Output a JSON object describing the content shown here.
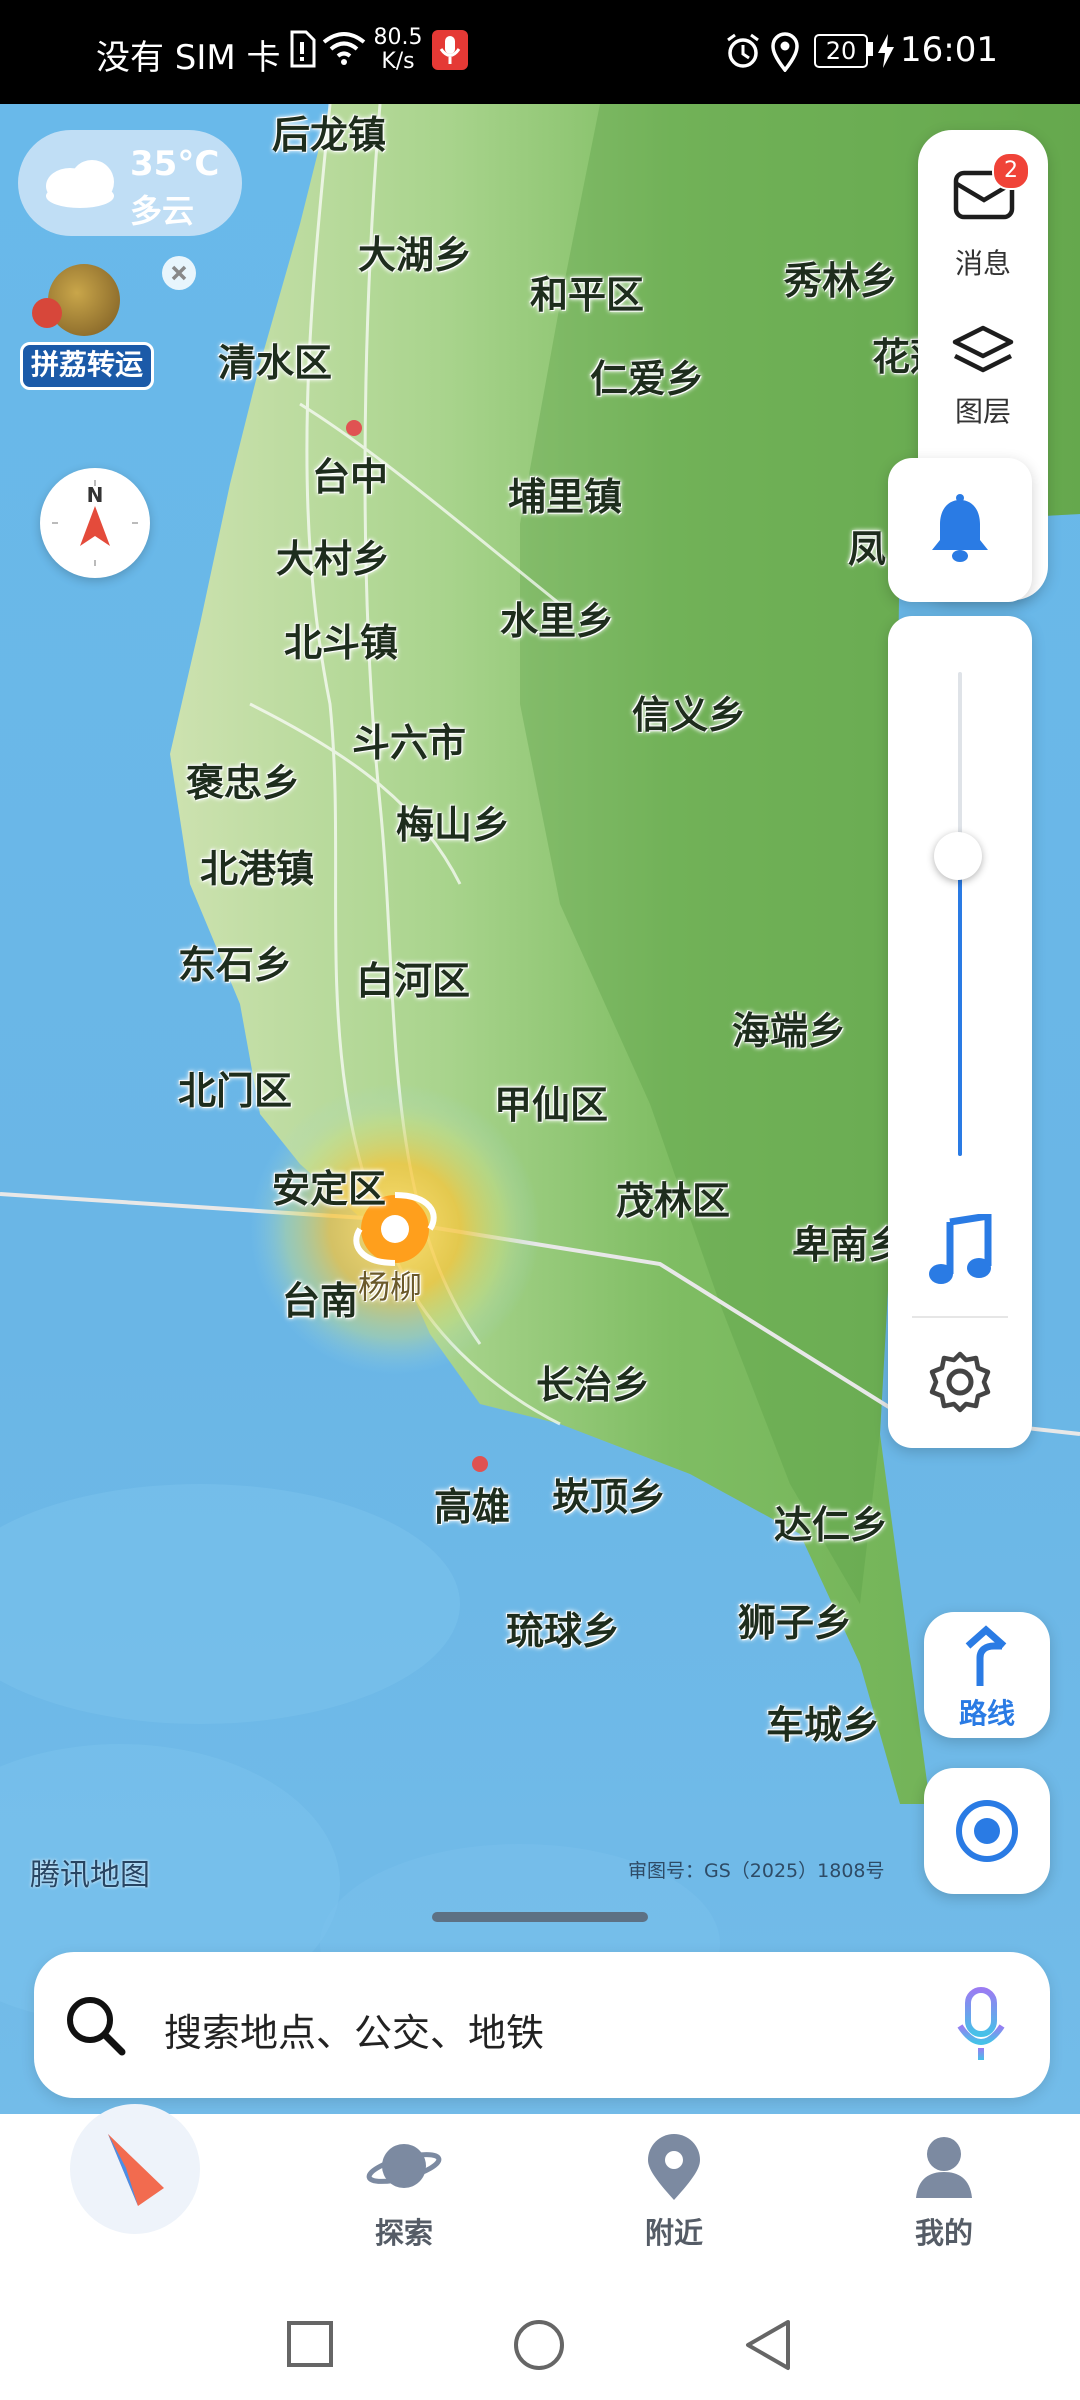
{
  "status_bar": {
    "sim": "没有 SIM 卡",
    "speed_value": "80.5",
    "speed_unit": "K/s",
    "battery": "20",
    "time": "16:01"
  },
  "weather": {
    "temperature": "35°C",
    "condition": "多云"
  },
  "promo": {
    "label": "拼荔转运"
  },
  "right_panel": {
    "messages_label": "消息",
    "messages_badge": "2",
    "layers_label": "图层"
  },
  "volume_level_percent": 62,
  "route_button": {
    "label": "路线"
  },
  "typhoon": {
    "name": "杨柳"
  },
  "map": {
    "watermark": "腾讯地图",
    "approval": "审图号：GS（2025）1808号",
    "places": [
      "后龙镇",
      "大湖乡",
      "和平区",
      "秀林乡",
      "花莲",
      "清水区",
      "仁爱乡",
      "台中",
      "埔里镇",
      "凤",
      "大村乡",
      "北斗镇",
      "水里乡",
      "信义乡",
      "斗六市",
      "褒忠乡",
      "梅山乡",
      "北港镇",
      "东石乡",
      "白河区",
      "海端乡",
      "北门区",
      "甲仙区",
      "安定区",
      "茂林区",
      "卑南乡",
      "台南",
      "长治乡",
      "高雄",
      "崁顶乡",
      "达仁乡",
      "琉球乡",
      "狮子乡",
      "车城乡"
    ]
  },
  "search": {
    "placeholder": "搜索地点、公交、地铁"
  },
  "bottom_nav": {
    "explore": "探索",
    "nearby": "附近",
    "mine": "我的"
  },
  "colors": {
    "accent": "#2a7be4",
    "land": "#8fc872",
    "sea": "#68b8e8",
    "typhoon": "#f5b92a"
  }
}
